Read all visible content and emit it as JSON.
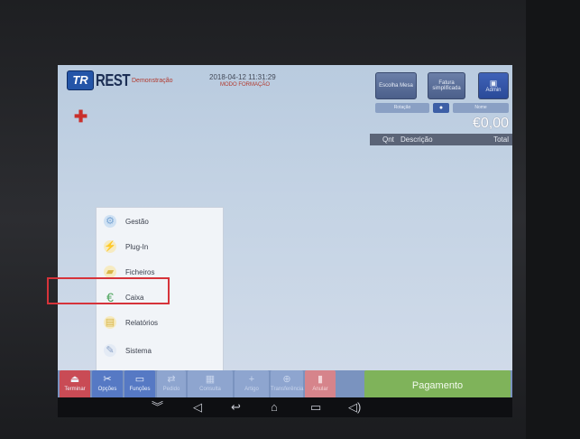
{
  "header": {
    "logo_mark": "TR",
    "logo_text": "REST",
    "demo_label": "Demonstração",
    "datetime": "2018-04-12  11:31:29",
    "mode": "MODO FORMAÇÃO"
  },
  "top_buttons": {
    "escolha_mesa": "Escolha Mesa",
    "fatura": "Fatura simplificada",
    "admin": "Admin"
  },
  "tabs": {
    "tab1": "Rotação",
    "tab2": "Nome"
  },
  "receipt": {
    "total_amount": "€0,00",
    "col_qnt": "Qnt",
    "col_desc": "Descrição",
    "col_total": "Total"
  },
  "menu": {
    "items": [
      {
        "label": "Gestão",
        "icon": "gear-icon"
      },
      {
        "label": "Plug-In",
        "icon": "plug-icon"
      },
      {
        "label": "Ficheiros",
        "icon": "folder-icon"
      },
      {
        "label": "Caixa",
        "icon": "euro-icon"
      },
      {
        "label": "Relatórios",
        "icon": "chart-icon"
      },
      {
        "label": "Sistema",
        "icon": "wrench-icon"
      }
    ],
    "selected": "Sistema"
  },
  "bottom_bar": {
    "terminar": "Terminar",
    "opcoes": "Opções",
    "funcoes": "Funções",
    "pedido": "Pedido",
    "consulta": "Consulta",
    "artigo": "Artigo",
    "transferencia": "Transferência",
    "anular": "Anular",
    "pagamento": "Pagamento"
  },
  "colors": {
    "accent_blue": "#5679c4",
    "terminar_red": "#c94b55",
    "pay_green": "#7fb35a",
    "highlight": "#d6333a"
  }
}
